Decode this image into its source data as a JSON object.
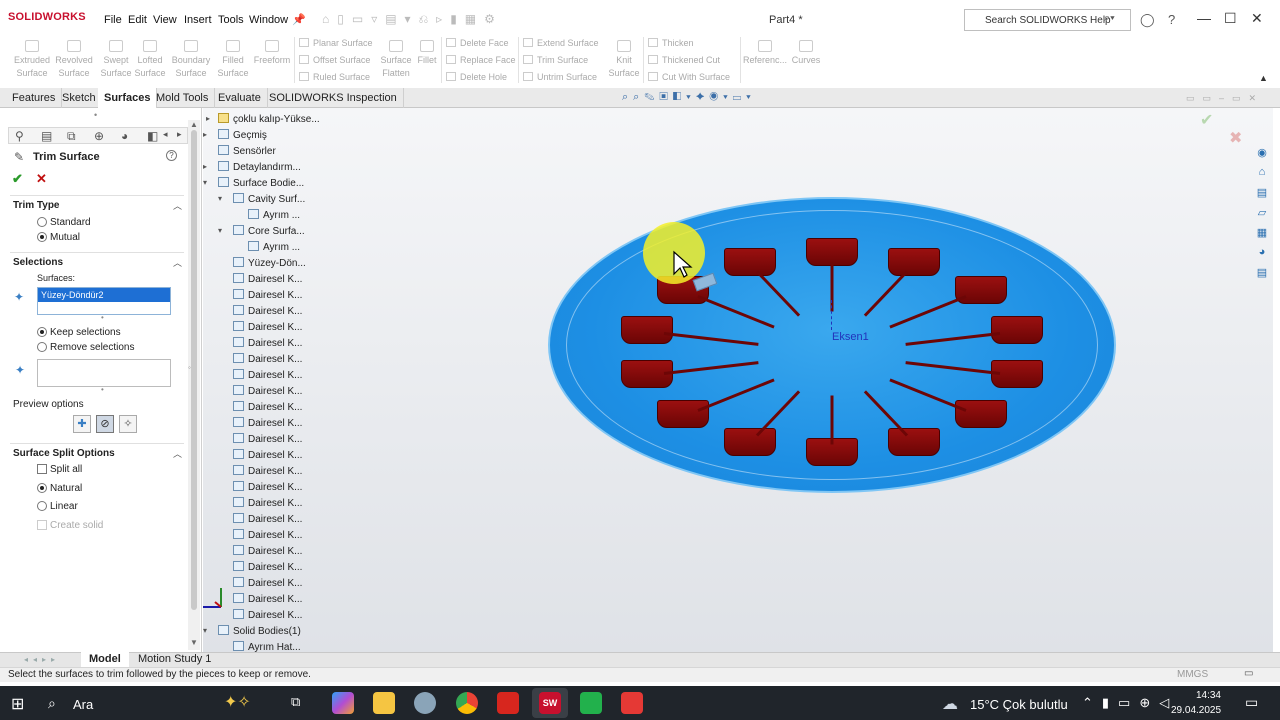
{
  "app": {
    "logo": "SOLIDWORKS",
    "document_title": "Part4 *",
    "menu": [
      "File",
      "Edit",
      "View",
      "Insert",
      "Tools",
      "Window"
    ],
    "help_placeholder": "Search SOLIDWORKS Help"
  },
  "ribbon": {
    "big_buttons": [
      "Extruded Surface",
      "Revolved Surface",
      "Swept Surface",
      "Lofted Surface",
      "Boundary Surface",
      "Filled Surface",
      "Freeform"
    ],
    "group1": [
      "Planar Surface",
      "Offset Surface",
      "Ruled Surface"
    ],
    "mid_big": [
      "Surface Flatten",
      "Fillet"
    ],
    "group2": [
      "Delete Face",
      "Replace Face",
      "Delete Hole"
    ],
    "group3": [
      "Extend Surface",
      "Trim Surface",
      "Untrim Surface"
    ],
    "knit": "Knit Surface",
    "group4": [
      "Thicken",
      "Thickened Cut",
      "Cut With Surface"
    ],
    "refs": [
      "Referenc...",
      "Curves"
    ]
  },
  "tabs": [
    "Features",
    "Sketch",
    "Surfaces",
    "Mold Tools",
    "Evaluate",
    "SOLIDWORKS Inspection"
  ],
  "active_tab": "Surfaces",
  "property_manager": {
    "title": "Trim Surface",
    "trim_type": {
      "label": "Trim Type",
      "options": [
        "Standard",
        "Mutual"
      ],
      "selected": "Mutual"
    },
    "selections": {
      "label": "Selections",
      "surfaces_label": "Surfaces:",
      "surfaces_value": "Yüzey-Döndür2",
      "keep": "Keep selections",
      "remove": "Remove selections",
      "selected": "Keep selections"
    },
    "preview": "Preview options",
    "split": {
      "label": "Surface Split Options",
      "split_all": "Split all",
      "natural": "Natural",
      "linear": "Linear",
      "create_solid": "Create solid",
      "selected": "Natural"
    }
  },
  "tree": {
    "root": "çoklu kalıp-Yükse...",
    "items": [
      {
        "label": "Geçmiş",
        "level": 1,
        "toggle": "▸"
      },
      {
        "label": "Sensörler",
        "level": 1,
        "toggle": ""
      },
      {
        "label": "Detaylandırm...",
        "level": 1,
        "toggle": "▸"
      },
      {
        "label": "Surface Bodie...",
        "level": 1,
        "toggle": "▾"
      },
      {
        "label": "Cavity Surf...",
        "level": 2,
        "toggle": "▾"
      },
      {
        "label": "Ayrım ...",
        "level": 3,
        "toggle": ""
      },
      {
        "label": "Core Surfa...",
        "level": 2,
        "toggle": "▾"
      },
      {
        "label": "Ayrım ...",
        "level": 3,
        "toggle": ""
      },
      {
        "label": "Yüzey-Dön...",
        "level": 2,
        "toggle": ""
      },
      {
        "label": "Dairesel K...",
        "level": 2,
        "toggle": ""
      },
      {
        "label": "Dairesel K...",
        "level": 2,
        "toggle": ""
      },
      {
        "label": "Dairesel K...",
        "level": 2,
        "toggle": ""
      },
      {
        "label": "Dairesel K...",
        "level": 2,
        "toggle": ""
      },
      {
        "label": "Dairesel K...",
        "level": 2,
        "toggle": ""
      },
      {
        "label": "Dairesel K...",
        "level": 2,
        "toggle": ""
      },
      {
        "label": "Dairesel K...",
        "level": 2,
        "toggle": ""
      },
      {
        "label": "Dairesel K...",
        "level": 2,
        "toggle": ""
      },
      {
        "label": "Dairesel K...",
        "level": 2,
        "toggle": ""
      },
      {
        "label": "Dairesel K...",
        "level": 2,
        "toggle": ""
      },
      {
        "label": "Dairesel K...",
        "level": 2,
        "toggle": ""
      },
      {
        "label": "Dairesel K...",
        "level": 2,
        "toggle": ""
      },
      {
        "label": "Dairesel K...",
        "level": 2,
        "toggle": ""
      },
      {
        "label": "Dairesel K...",
        "level": 2,
        "toggle": ""
      },
      {
        "label": "Dairesel K...",
        "level": 2,
        "toggle": ""
      },
      {
        "label": "Dairesel K...",
        "level": 2,
        "toggle": ""
      },
      {
        "label": "Dairesel K...",
        "level": 2,
        "toggle": ""
      },
      {
        "label": "Dairesel K...",
        "level": 2,
        "toggle": ""
      },
      {
        "label": "Dairesel K...",
        "level": 2,
        "toggle": ""
      },
      {
        "label": "Dairesel K...",
        "level": 2,
        "toggle": ""
      },
      {
        "label": "Dairesel K...",
        "level": 2,
        "toggle": ""
      },
      {
        "label": "Dairesel K...",
        "level": 2,
        "toggle": ""
      },
      {
        "label": "Solid Bodies(1)",
        "level": 1,
        "toggle": "▾"
      },
      {
        "label": "Ayrım Hat...",
        "level": 2,
        "toggle": ""
      }
    ]
  },
  "viewport": {
    "axis_label": "Eksen1"
  },
  "bottom_tabs": [
    "Model",
    "Motion Study 1"
  ],
  "status": {
    "message": "Select the surfaces to trim followed by the pieces to keep or remove.",
    "units": "MMGS"
  },
  "taskbar": {
    "search": "Ara",
    "weather": "15°C  Çok bulutlu",
    "time": "14:34",
    "date": "29.04.2025"
  }
}
